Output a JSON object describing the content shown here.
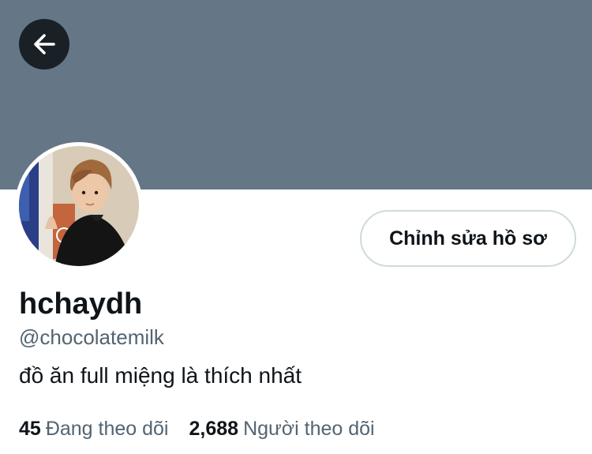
{
  "colors": {
    "banner": "#657786",
    "text_primary": "#0f1419",
    "text_secondary": "#536471",
    "button_border": "#cfd9de"
  },
  "header": {
    "back_icon": "arrow-left-icon"
  },
  "profile": {
    "avatar_icon": "profile-photo",
    "edit_button_label": "Chỉnh sửa hồ sơ",
    "display_name": "hchaydh",
    "handle": "@chocolatemilk",
    "bio": "đồ ăn full miệng là thích nhất"
  },
  "stats": {
    "following_count": "45",
    "following_label": "Đang theo dõi",
    "followers_count": "2,688",
    "followers_label": "Người theo dõi"
  }
}
